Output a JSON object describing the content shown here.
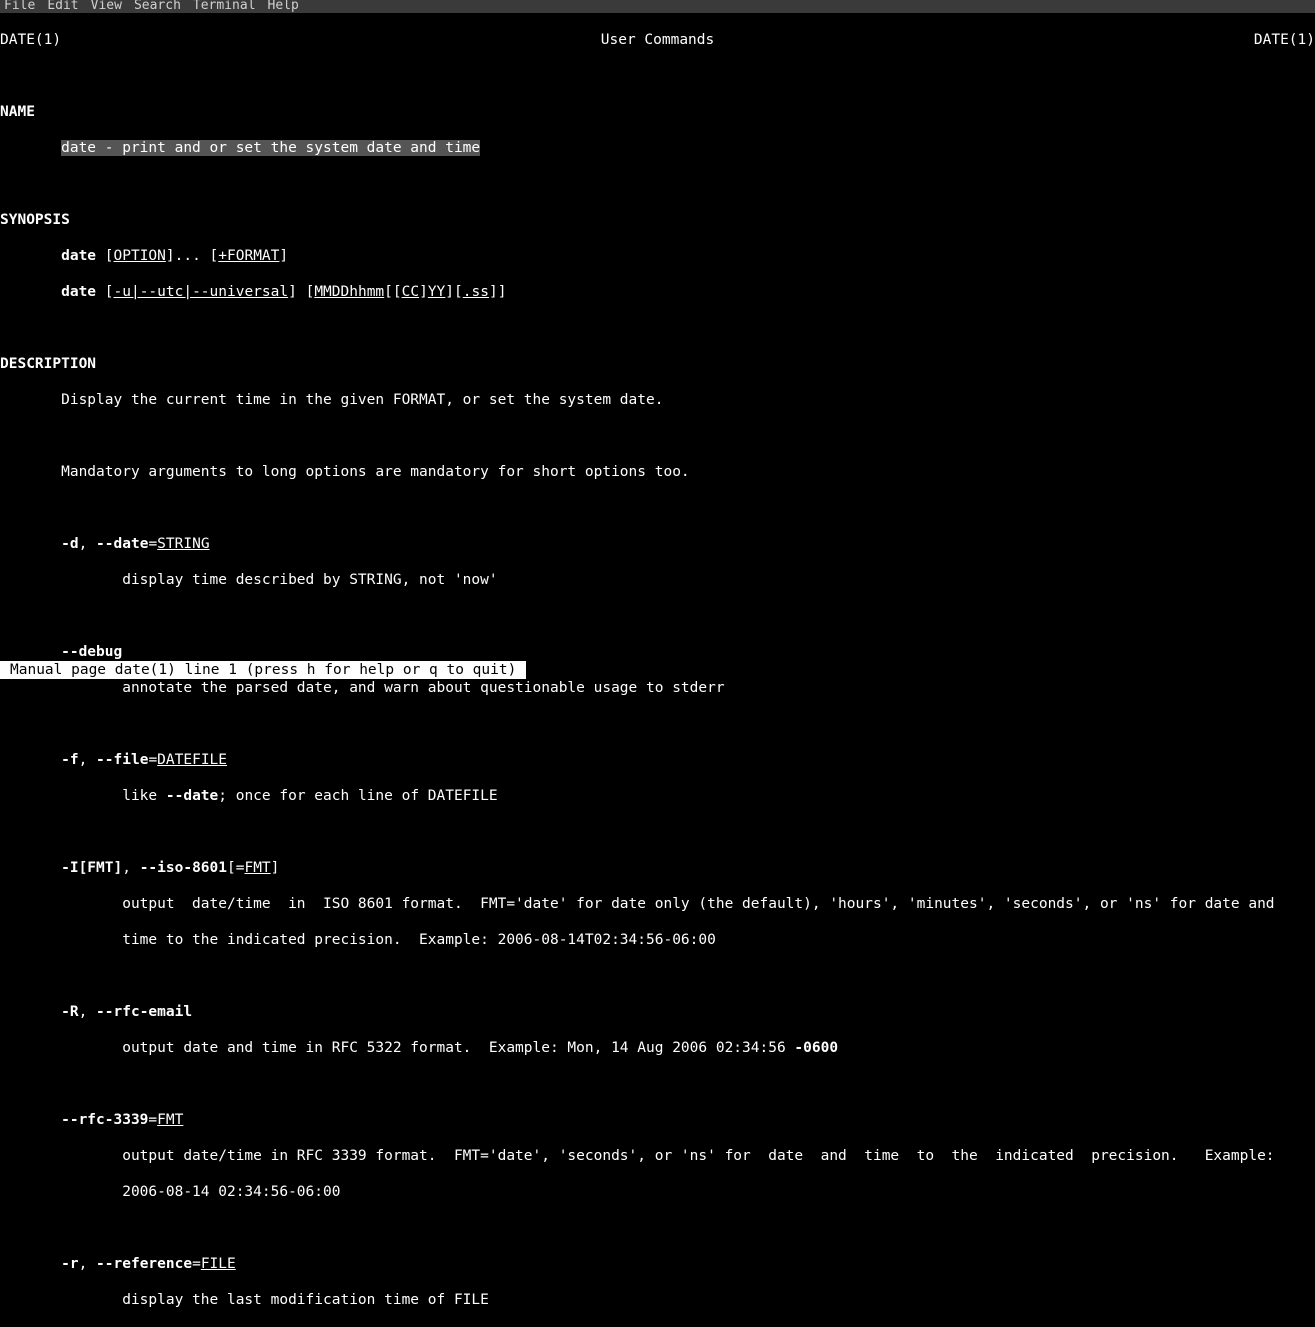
{
  "menubar": [
    "File",
    "Edit",
    "View",
    "Search",
    "Terminal",
    "Help"
  ],
  "header": {
    "left": "DATE(1)",
    "center": "User Commands",
    "right": "DATE(1)"
  },
  "sections": {
    "name_hdr": "NAME",
    "name_text": "date - print and or set the system date and time",
    "name_pre": "       ",
    "syn_hdr": "SYNOPSIS",
    "syn1": {
      "pre": "       ",
      "cmd": "date",
      "sp": " [",
      "opt": "OPTION",
      "mid": "]... [",
      "fmt": "+FORMAT",
      "end": "]"
    },
    "syn2": {
      "pre": "       ",
      "cmd": "date",
      "sp": " [",
      "u1": "-u|--utc|--universal",
      "mid1": "] [",
      "u2": "MMDDhhmm",
      "mid2": "[[",
      "u3": "CC",
      "mid3": "]",
      "u4": "YY",
      "mid4": "][",
      "u5": ".ss",
      "end": "]]"
    },
    "desc_hdr": "DESCRIPTION",
    "desc1": "       Display the current time in the given FORMAT, or set the system date.",
    "desc2": "       Mandatory arguments to long options are mandatory for short options too.",
    "o_d": {
      "pre": "       ",
      "s": "-d",
      "c": ", ",
      "l": "--date",
      "eq": "=",
      "arg": "STRING"
    },
    "o_d_desc": "              display time described by STRING, not 'now'",
    "o_debug": {
      "pre": "       ",
      "l": "--debug"
    },
    "o_debug_desc": "              annotate the parsed date, and warn about questionable usage to stderr",
    "o_f": {
      "pre": "       ",
      "s": "-f",
      "c": ", ",
      "l": "--file",
      "eq": "=",
      "arg": "DATEFILE"
    },
    "o_f_desc": {
      "pre": "              like ",
      "b": "--date",
      "post": "; once for each line of DATEFILE"
    },
    "o_I": {
      "pre": "       ",
      "s": "-I[FMT]",
      "c": ", ",
      "l": "--iso-8601",
      "eq": "[=",
      "arg": "FMT",
      "end": "]"
    },
    "o_I_desc1": "              output  date/time  in  ISO 8601 format.  FMT='date' for date only (the default), 'hours', 'minutes', 'seconds', or 'ns' for date and",
    "o_I_desc2": "              time to the indicated precision.  Example: 2006-08-14T02:34:56-06:00",
    "o_R": {
      "pre": "       ",
      "s": "-R",
      "c": ", ",
      "l": "--rfc-email"
    },
    "o_R_desc": {
      "pre": "              output date and time in RFC 5322 format.  Example: Mon, 14 Aug 2006 02:34:56 ",
      "b": "-0600"
    },
    "o_3339": {
      "pre": "       ",
      "l": "--rfc-3339",
      "eq": "=",
      "arg": "FMT"
    },
    "o_3339_desc1": "              output date/time in RFC 3339 format.  FMT='date', 'seconds', or 'ns' for  date  and  time  to  the  indicated  precision.   Example:",
    "o_3339_desc2": "              2006-08-14 02:34:56-06:00",
    "o_r": {
      "pre": "       ",
      "s": "-r",
      "c": ", ",
      "l": "--reference",
      "eq": "=",
      "arg": "FILE"
    },
    "o_r_desc": "              display the last modification time of FILE"
  },
  "status": " Manual page date(1) line 1 (press h for help or q to quit)"
}
